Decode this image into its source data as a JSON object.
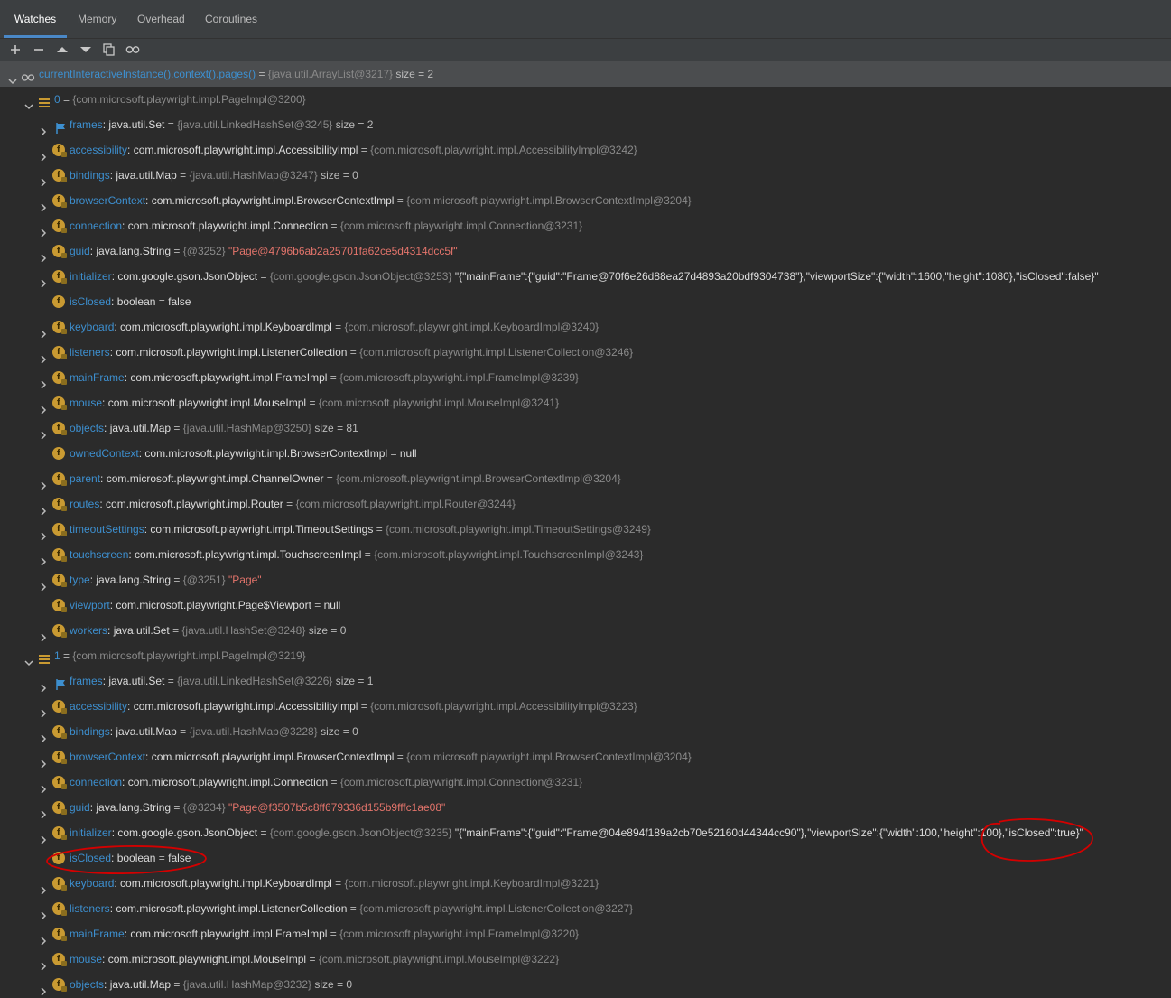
{
  "tabs": [
    "Watches",
    "Memory",
    "Overhead",
    "Coroutines"
  ],
  "toolbar": [
    "add-icon",
    "remove-icon",
    "move-up-icon",
    "move-down-icon",
    "duplicate-icon",
    "show-watches-icon"
  ],
  "root": {
    "expr": "currentInteractiveInstance().context().pages()",
    "ref": "{java.util.ArrayList@3217}",
    "size": "size = 2"
  },
  "pages": [
    {
      "label": "0",
      "ref": "{com.microsoft.playwright.impl.PageImpl@3200}",
      "fields": [
        {
          "name": "frames",
          "type": "java.util.Set",
          "ref": "{java.util.LinkedHashSet@3245}",
          "size": "size = 2"
        },
        {
          "name": "accessibility",
          "type": "com.microsoft.playwright.impl.AccessibilityImpl",
          "ref": "{com.microsoft.playwright.impl.AccessibilityImpl@3242}"
        },
        {
          "name": "bindings",
          "type": "java.util.Map",
          "ref": "{java.util.HashMap@3247}",
          "size": "size = 0"
        },
        {
          "name": "browserContext",
          "type": "com.microsoft.playwright.impl.BrowserContextImpl",
          "ref": "{com.microsoft.playwright.impl.BrowserContextImpl@3204}"
        },
        {
          "name": "connection",
          "type": "com.microsoft.playwright.impl.Connection",
          "ref": "{com.microsoft.playwright.impl.Connection@3231}"
        },
        {
          "name": "guid",
          "type": "java.lang.String",
          "ref": "{@3252}",
          "str": "\"Page@4796b6ab2a25701fa62ce5d4314dcc5f\""
        },
        {
          "name": "initializer",
          "type": "com.google.gson.JsonObject",
          "ref": "{com.google.gson.JsonObject@3253}",
          "json": "\"{\"mainFrame\":{\"guid\":\"Frame@70f6e26d88ea27d4893a20bdf9304738\"},\"viewportSize\":{\"width\":1600,\"height\":1080},\"isClosed\":false}\""
        },
        {
          "name": "isClosed",
          "type": "boolean",
          "value": "false"
        },
        {
          "name": "keyboard",
          "type": "com.microsoft.playwright.impl.KeyboardImpl",
          "ref": "{com.microsoft.playwright.impl.KeyboardImpl@3240}"
        },
        {
          "name": "listeners",
          "type": "com.microsoft.playwright.impl.ListenerCollection",
          "ref": "{com.microsoft.playwright.impl.ListenerCollection@3246}"
        },
        {
          "name": "mainFrame",
          "type": "com.microsoft.playwright.impl.FrameImpl",
          "ref": "{com.microsoft.playwright.impl.FrameImpl@3239}"
        },
        {
          "name": "mouse",
          "type": "com.microsoft.playwright.impl.MouseImpl",
          "ref": "{com.microsoft.playwright.impl.MouseImpl@3241}"
        },
        {
          "name": "objects",
          "type": "java.util.Map",
          "ref": "{java.util.HashMap@3250}",
          "size": "size = 81"
        },
        {
          "name": "ownedContext",
          "type": "com.microsoft.playwright.impl.BrowserContextImpl",
          "value": "null"
        },
        {
          "name": "parent",
          "type": "com.microsoft.playwright.impl.ChannelOwner",
          "ref": "{com.microsoft.playwright.impl.BrowserContextImpl@3204}"
        },
        {
          "name": "routes",
          "type": "com.microsoft.playwright.impl.Router",
          "ref": "{com.microsoft.playwright.impl.Router@3244}"
        },
        {
          "name": "timeoutSettings",
          "type": "com.microsoft.playwright.impl.TimeoutSettings",
          "ref": "{com.microsoft.playwright.impl.TimeoutSettings@3249}"
        },
        {
          "name": "touchscreen",
          "type": "com.microsoft.playwright.impl.TouchscreenImpl",
          "ref": "{com.microsoft.playwright.impl.TouchscreenImpl@3243}"
        },
        {
          "name": "type",
          "type": "java.lang.String",
          "ref": "{@3251}",
          "str": "\"Page\""
        },
        {
          "name": "viewport",
          "type": "com.microsoft.playwright.Page$Viewport",
          "value": "null"
        },
        {
          "name": "workers",
          "type": "java.util.Set",
          "ref": "{java.util.HashSet@3248}",
          "size": "size = 0"
        }
      ]
    },
    {
      "label": "1",
      "ref": "{com.microsoft.playwright.impl.PageImpl@3219}",
      "fields": [
        {
          "name": "frames",
          "type": "java.util.Set",
          "ref": "{java.util.LinkedHashSet@3226}",
          "size": "size = 1"
        },
        {
          "name": "accessibility",
          "type": "com.microsoft.playwright.impl.AccessibilityImpl",
          "ref": "{com.microsoft.playwright.impl.AccessibilityImpl@3223}"
        },
        {
          "name": "bindings",
          "type": "java.util.Map",
          "ref": "{java.util.HashMap@3228}",
          "size": "size = 0"
        },
        {
          "name": "browserContext",
          "type": "com.microsoft.playwright.impl.BrowserContextImpl",
          "ref": "{com.microsoft.playwright.impl.BrowserContextImpl@3204}"
        },
        {
          "name": "connection",
          "type": "com.microsoft.playwright.impl.Connection",
          "ref": "{com.microsoft.playwright.impl.Connection@3231}"
        },
        {
          "name": "guid",
          "type": "java.lang.String",
          "ref": "{@3234}",
          "str": "\"Page@f3507b5c8ff679336d155b9fffc1ae08\""
        },
        {
          "name": "initializer",
          "type": "com.google.gson.JsonObject",
          "ref": "{com.google.gson.JsonObject@3235}",
          "json": "\"{\"mainFrame\":{\"guid\":\"Frame@04e894f189a2cb70e52160d44344cc90\"},\"viewportSize\":{\"width\":100,\"height\":100},\"isClosed\":true}\""
        },
        {
          "name": "isClosed",
          "type": "boolean",
          "value": "false"
        },
        {
          "name": "keyboard",
          "type": "com.microsoft.playwright.impl.KeyboardImpl",
          "ref": "{com.microsoft.playwright.impl.KeyboardImpl@3221}"
        },
        {
          "name": "listeners",
          "type": "com.microsoft.playwright.impl.ListenerCollection",
          "ref": "{com.microsoft.playwright.impl.ListenerCollection@3227}"
        },
        {
          "name": "mainFrame",
          "type": "com.microsoft.playwright.impl.FrameImpl",
          "ref": "{com.microsoft.playwright.impl.FrameImpl@3220}"
        },
        {
          "name": "mouse",
          "type": "com.microsoft.playwright.impl.MouseImpl",
          "ref": "{com.microsoft.playwright.impl.MouseImpl@3222}"
        },
        {
          "name": "objects",
          "type": "java.util.Map",
          "ref": "{java.util.HashMap@3232}",
          "size": "size = 0"
        }
      ]
    }
  ],
  "colors": {
    "name": "#3d8fcf",
    "string": "#e3746b",
    "annotation": "#d40000",
    "field_icon": "#c99a32",
    "root_row": "#4b4d4f",
    "background": "#2b2b2b"
  }
}
